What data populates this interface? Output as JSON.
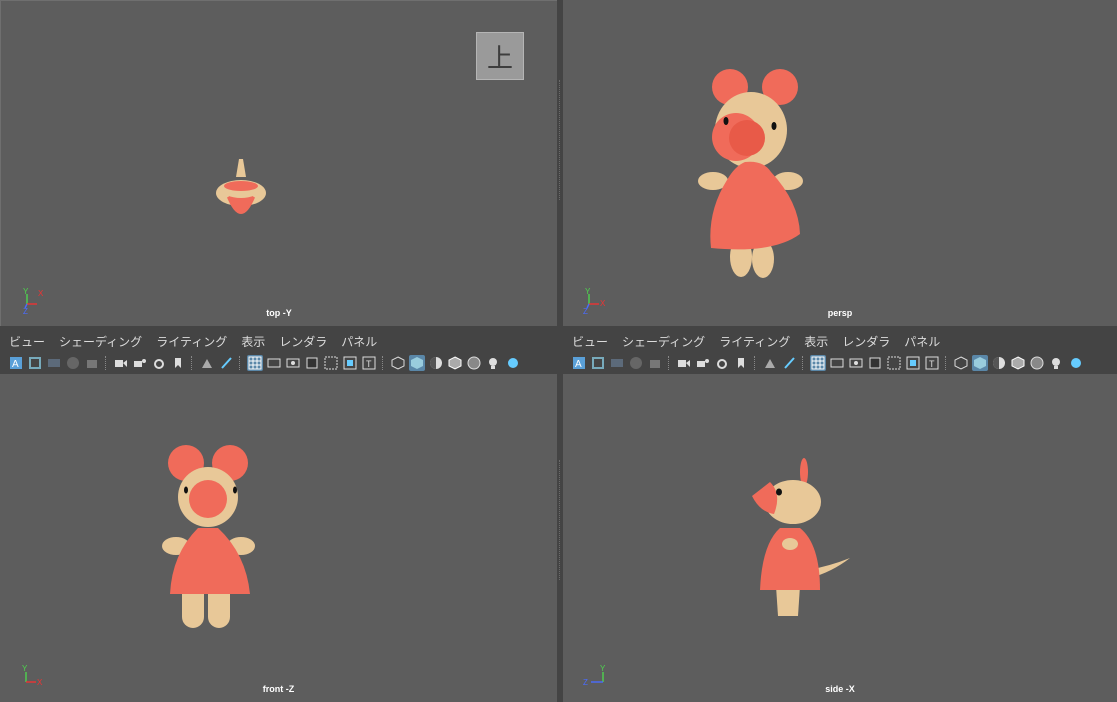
{
  "viewports": {
    "top_left": {
      "camera_label": "top -Y",
      "viewcube_label": "上"
    },
    "top_right": {
      "camera_label": "persp"
    },
    "bottom_left": {
      "camera_label": "front -Z"
    },
    "bottom_right": {
      "camera_label": "side -X"
    }
  },
  "panel_menu": [
    "ビュー",
    "シェーディング",
    "ライティング",
    "表示",
    "レンダラ",
    "パネル"
  ],
  "axis_labels": {
    "x": "X",
    "y": "Y",
    "z": "Z"
  },
  "colors": {
    "viewport_bg": "#5d5d5d",
    "ui_bg": "#444444",
    "character_skin": "#e8c898",
    "character_red": "#f06b5a",
    "toolbar_active": "#5a87a8"
  },
  "toolbar_icons": [
    "select-camera-icon",
    "camera-attributes-icon",
    "bookmark-icon",
    "image-plane-icon",
    "2d-pan-zoom-icon",
    "grease-pencil-icon",
    "grid-icon",
    "film-gate-icon",
    "resolution-gate-icon",
    "gate-mask-icon",
    "field-chart-icon",
    "safe-action-icon",
    "safe-title-icon",
    "wireframe-icon",
    "smooth-shade-icon",
    "use-default-material-icon",
    "wireframe-on-shaded-icon",
    "xray-icon",
    "lights-icon",
    "shadows-icon"
  ]
}
